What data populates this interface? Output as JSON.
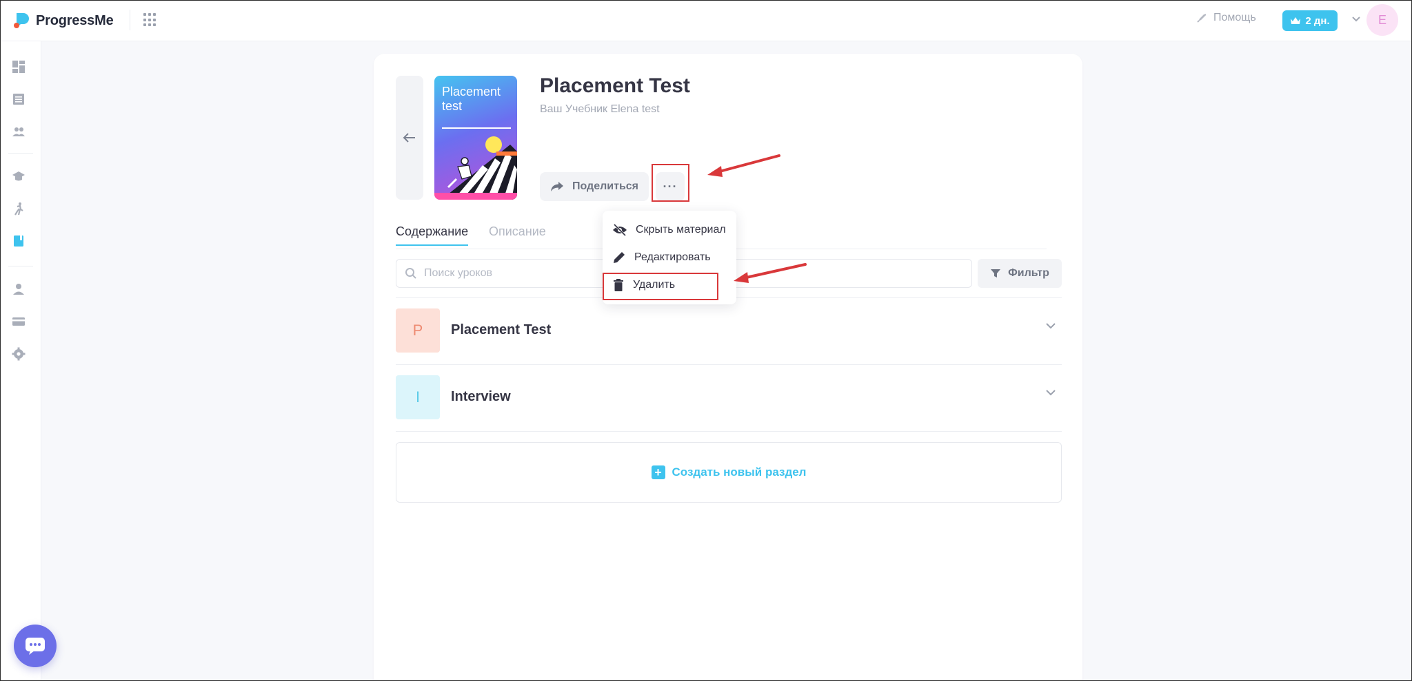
{
  "app": {
    "name": "ProgressMe"
  },
  "header": {
    "help_label": "Помощь",
    "premium_label": "2 дн.",
    "avatar_initial": "E"
  },
  "material": {
    "cover_title": "Placement test",
    "title": "Placement Test",
    "subtitle": "Ваш Учебник Elena test",
    "share_label": "Поделиться",
    "more_label": "···"
  },
  "tabs": [
    {
      "label": "Содержание",
      "active": true
    },
    {
      "label": "Описание",
      "active": false
    }
  ],
  "search": {
    "placeholder": "Поиск уроков"
  },
  "filter_label": "Фильтр",
  "sections": [
    {
      "initial": "P",
      "title": "Placement Test",
      "badge_bg": "#fde0d8",
      "badge_fg": "#ee8b72"
    },
    {
      "initial": "I",
      "title": "Interview",
      "badge_bg": "#dcf5fb",
      "badge_fg": "#5bcbe8"
    }
  ],
  "create_label": "Создать новый раздел",
  "menu": {
    "items": [
      {
        "label": "Скрыть материал",
        "icon": "eye-off-icon"
      },
      {
        "label": "Редактировать",
        "icon": "pencil-icon"
      },
      {
        "label": "Удалить",
        "icon": "trash-icon"
      }
    ]
  },
  "colors": {
    "accent": "#3ec3ee",
    "annotation": "#d9383a",
    "chat": "#6c6fe8"
  }
}
